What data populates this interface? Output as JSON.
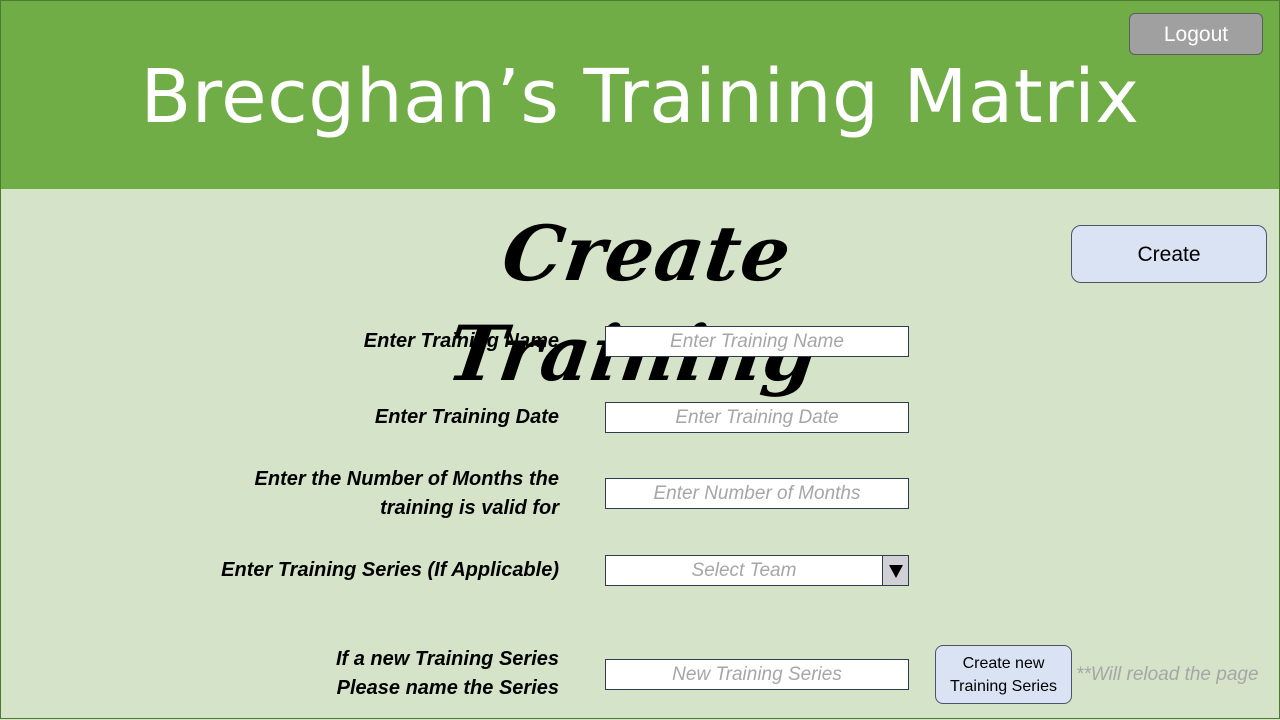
{
  "header": {
    "title": "Brecghan’s Training Matrix",
    "logout_label": "Logout"
  },
  "page": {
    "title": "Create Training",
    "create_label": "Create"
  },
  "form": {
    "name": {
      "label": "Enter Training Name",
      "placeholder": "Enter Training Name",
      "value": ""
    },
    "date": {
      "label": "Enter Training Date",
      "placeholder": "Enter Training Date",
      "value": ""
    },
    "months": {
      "label_line1": "Enter the Number of Months the",
      "label_line2": "training is valid for",
      "placeholder": "Enter Number of Months",
      "value": ""
    },
    "series": {
      "label": "Enter Training Series (If Applicable)",
      "selected": "Select Team"
    },
    "new_series": {
      "label_line1": "If a new Training Series",
      "label_line2": "Please name the Series",
      "placeholder": "New Training Series",
      "value": "",
      "button_line1": "Create new",
      "button_line2": "Training Series",
      "note": "**Will reload the page"
    }
  },
  "icons": {
    "dropdown": "triangle-down-icon"
  },
  "colors": {
    "header_bg": "#70ad47",
    "page_bg": "#d5e4c9",
    "button_bg": "#dae3f3",
    "logout_bg": "#a0a0a0"
  }
}
